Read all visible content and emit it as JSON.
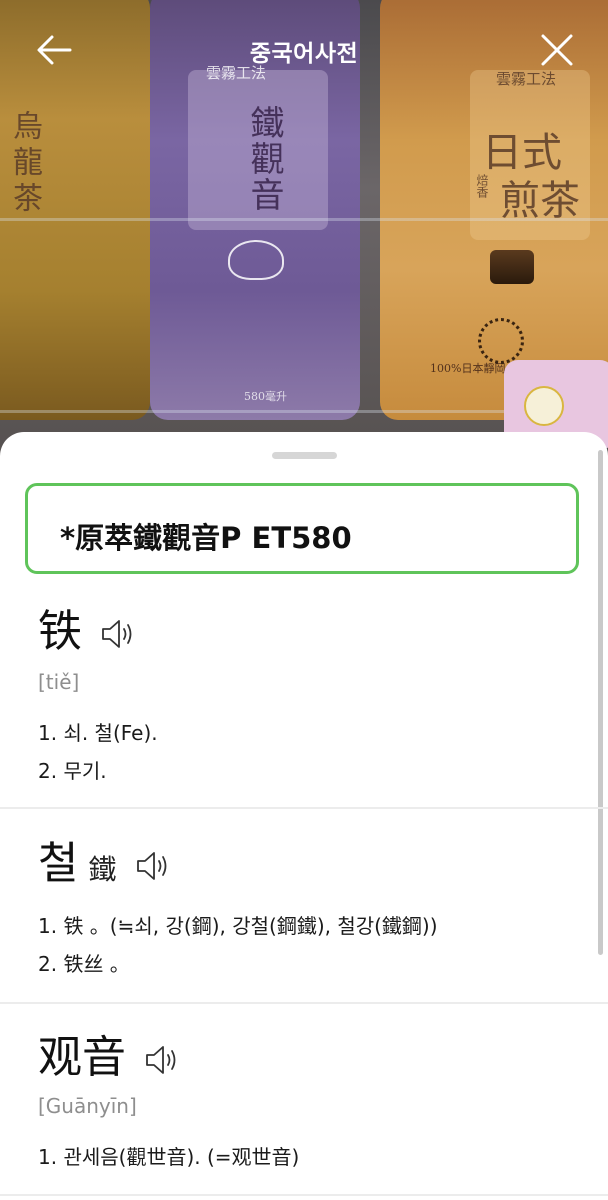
{
  "header": {
    "title": "중국어사전"
  },
  "photo": {
    "left_label": "烏龍茶",
    "mid_brand": "雲霧工法",
    "mid_name": "鐵觀音",
    "right_brand": "雲霧工法",
    "right_name_1": "日式",
    "right_name_2": "煎茶",
    "right_small": "焙香",
    "mid_volume": "580毫升",
    "right_bottom": "100%日本靜岡"
  },
  "recognized": {
    "text": "*原萃鐵觀音P ET580"
  },
  "entries": [
    {
      "headword": "铁",
      "pinyin": "[tiě]",
      "senses": [
        "1. 쇠. 철(Fe).",
        "2. 무기."
      ]
    },
    {
      "headword": "철",
      "hanja": "鐵",
      "senses": [
        "1. 铁 。(≒쇠, 강(鋼), 강철(鋼鐵), 철강(鐵鋼))",
        "2. 铁丝 。"
      ]
    },
    {
      "headword": "观音",
      "pinyin": "[Guānyīn]",
      "senses": [
        "1. 관세음(觀世音). (=观世音)"
      ]
    }
  ],
  "colors": {
    "accent_border": "#5fc45a",
    "sheet_bg": "#ffffff",
    "muted_text": "#8e8e8e"
  }
}
